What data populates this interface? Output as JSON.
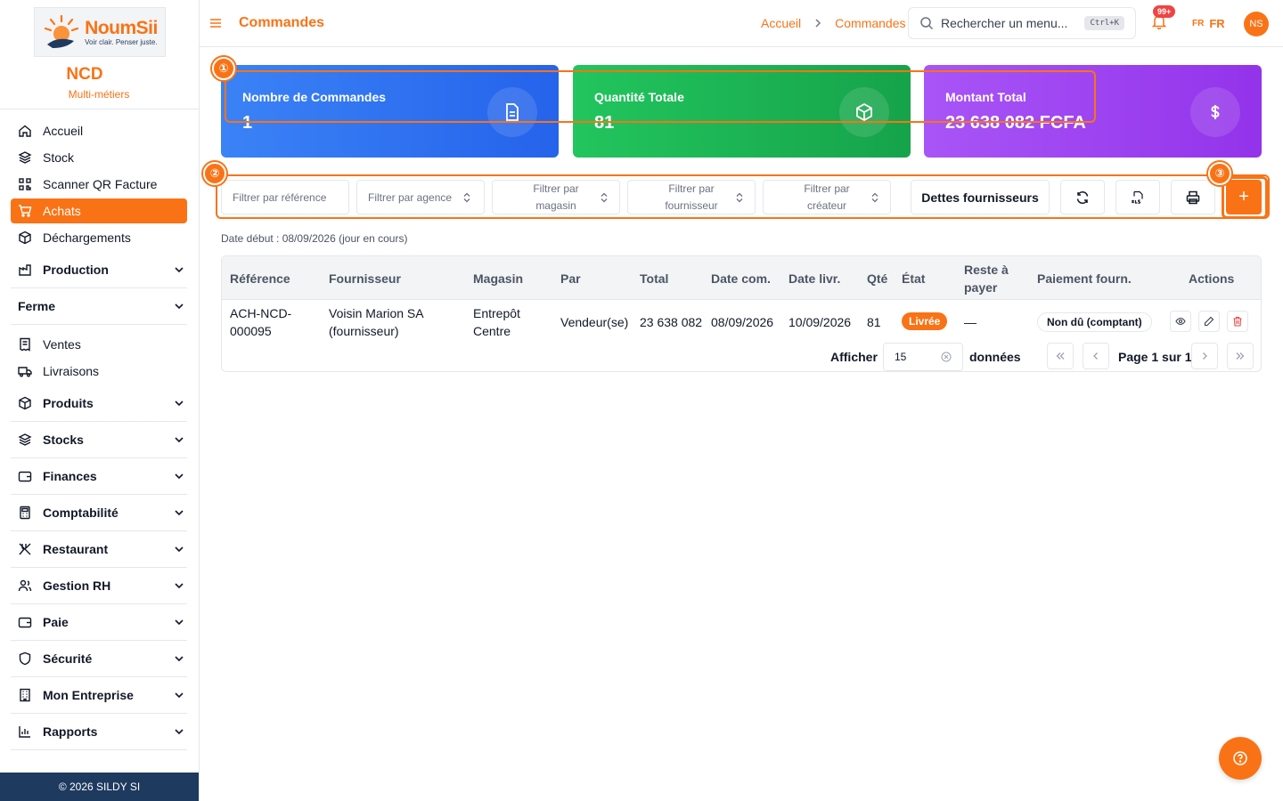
{
  "brand": {
    "logo_name": "NoumSii",
    "logo_tagline": "Voir clair. Penser juste.",
    "org_name": "NCD",
    "org_subtitle": "Multi-métiers"
  },
  "sidebar": {
    "items": [
      {
        "label": "Accueil",
        "icon": "home-icon"
      },
      {
        "label": "Stock",
        "icon": "layers-icon"
      },
      {
        "label": "Scanner QR Facture",
        "icon": "qr-icon"
      },
      {
        "label": "Achats",
        "icon": "cart-icon",
        "active": true
      },
      {
        "label": "Déchargements",
        "icon": "box-icon"
      }
    ],
    "group_production": "Production",
    "section_ferme": "Ferme",
    "ferme_items": [
      {
        "label": "Ventes",
        "icon": "receipt-icon"
      },
      {
        "label": "Livraisons",
        "icon": "truck-icon"
      }
    ],
    "groups": [
      {
        "label": "Produits",
        "icon": "box-icon"
      },
      {
        "label": "Stocks",
        "icon": "layers-icon"
      },
      {
        "label": "Finances",
        "icon": "wallet-icon"
      },
      {
        "label": "Comptabilité",
        "icon": "calculator-icon"
      },
      {
        "label": "Restaurant",
        "icon": "utensils-icon"
      },
      {
        "label": "Gestion RH",
        "icon": "users-icon"
      },
      {
        "label": "Paie",
        "icon": "wallet-icon"
      },
      {
        "label": "Sécurité",
        "icon": "shield-icon"
      },
      {
        "label": "Mon Entreprise",
        "icon": "building-icon"
      },
      {
        "label": "Rapports",
        "icon": "chart-icon"
      }
    ],
    "footer": "© 2026 SILDY SI"
  },
  "header": {
    "title": "Commandes",
    "breadcrumb": [
      "Accueil",
      "Commandes"
    ],
    "search_placeholder": "Rechercher un menu...",
    "search_shortcut": "Ctrl+K",
    "notif_badge": "99+",
    "lang_flag": "FR",
    "lang_code": "FR",
    "avatar": "NS"
  },
  "cards": [
    {
      "label": "Nombre de Commandes",
      "value": "1",
      "icon": "document-icon"
    },
    {
      "label": "Quantité Totale",
      "value": "81",
      "icon": "cube-icon"
    },
    {
      "label": "Montant Total",
      "value": "23 638 082 FCFA",
      "icon": "dollar-icon"
    }
  ],
  "callouts": [
    "①",
    "②",
    "③"
  ],
  "filters": {
    "reference_placeholder": "Filtrer par référence",
    "agence": "Filtrer par agence",
    "magasin": "Filtrer par magasin",
    "fournisseur": "Filtrer par fournisseur",
    "createur": "Filtrer par créateur",
    "dettes_button": "Dettes fournisseurs",
    "add_button": "+"
  },
  "date_info": "Date début : 08/09/2026 (jour en cours)",
  "table": {
    "headers": [
      "Référence",
      "Fournisseur",
      "Magasin",
      "Par",
      "Total",
      "Date com.",
      "Date livr.",
      "Qté",
      "État",
      "Reste à payer",
      "Paiement fourn.",
      "Actions"
    ],
    "rows": [
      {
        "reference": "ACH-NCD-000095",
        "fournisseur": "Voisin Marion SA (fournisseur)",
        "magasin": "Entrepôt Centre",
        "par": "Vendeur(se)",
        "total": "23 638 082",
        "date_com": "08/09/2026",
        "date_livr": "10/09/2026",
        "qte": "81",
        "etat": "Livrée",
        "reste": "—",
        "paiement": "Non dû (comptant)"
      }
    ]
  },
  "pagination": {
    "show_label": "Afficher",
    "page_size": "15",
    "rows_label": "données",
    "page_text": "Page 1 sur 1"
  },
  "colors": {
    "accent": "#f97316",
    "card_blue": "#2563eb",
    "card_green": "#16a34a",
    "card_purple": "#9333ea",
    "footer": "#1e3a5f"
  }
}
